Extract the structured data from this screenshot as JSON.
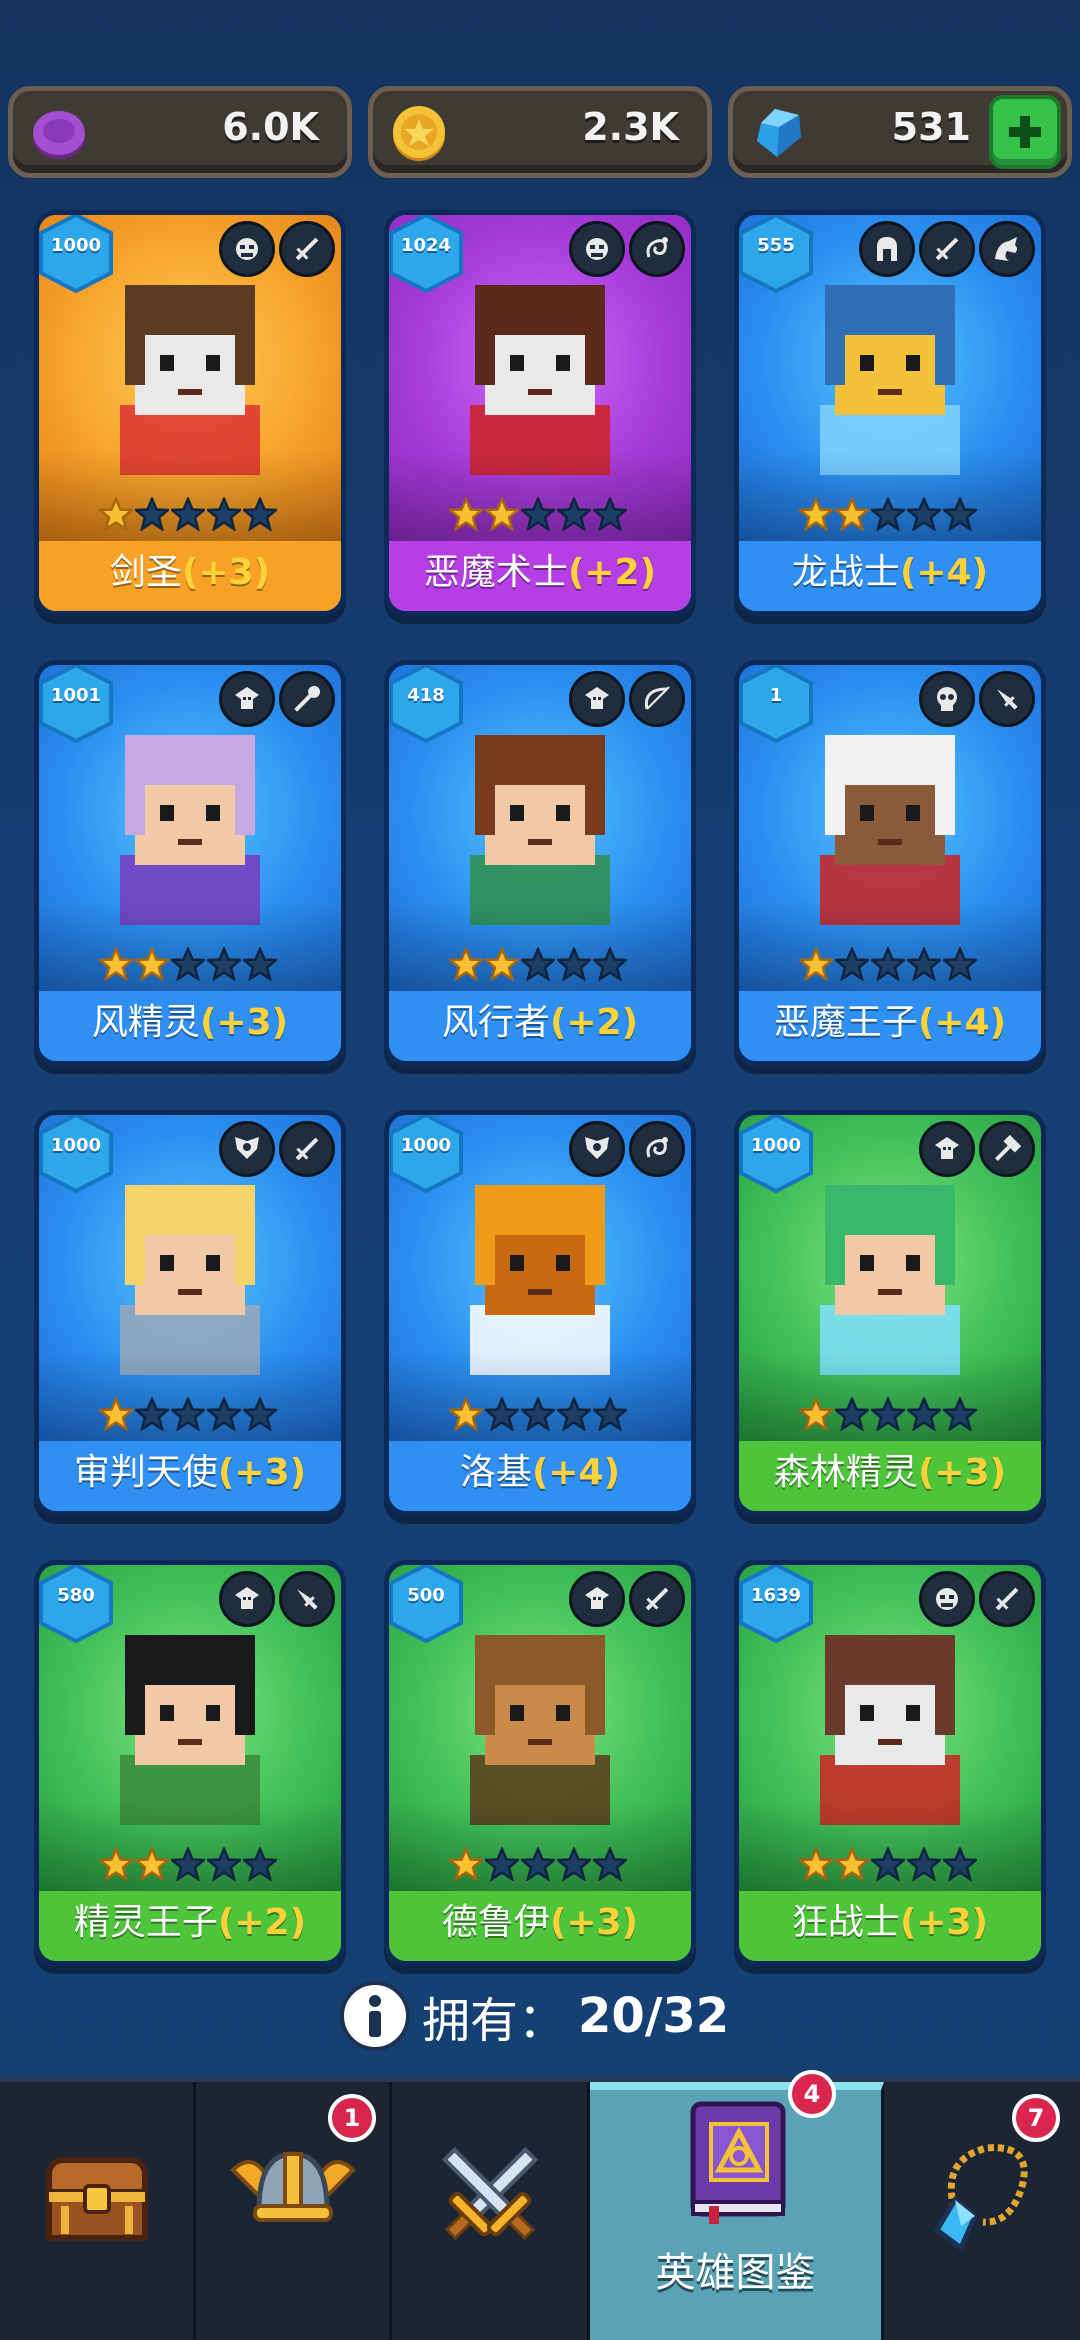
{
  "currency": {
    "elixir": "6.0K",
    "gold": "2.3K",
    "gems": "531"
  },
  "heroes": [
    {
      "name": "剑圣",
      "bonus": "(+3)",
      "level": "1000",
      "stars": 1,
      "rarity": "orange",
      "roles": [
        "orc-face-icon",
        "sword-icon"
      ]
    },
    {
      "name": "恶魔术士",
      "bonus": "(+2)",
      "level": "1024",
      "stars": 2,
      "rarity": "purple",
      "roles": [
        "orc-face-icon",
        "magic-swirl-icon"
      ]
    },
    {
      "name": "龙战士",
      "bonus": "(+4)",
      "level": "555",
      "stars": 2,
      "rarity": "blue",
      "roles": [
        "spartan-helmet-icon",
        "sword-icon",
        "dragon-icon"
      ]
    },
    {
      "name": "风精灵",
      "bonus": "(+3)",
      "level": "1001",
      "stars": 2,
      "rarity": "blue",
      "roles": [
        "elf-face-icon",
        "staff-icon"
      ]
    },
    {
      "name": "风行者",
      "bonus": "(+2)",
      "level": "418",
      "stars": 2,
      "rarity": "blue",
      "roles": [
        "elf-face-icon",
        "bow-icon"
      ]
    },
    {
      "name": "恶魔王子",
      "bonus": "(+4)",
      "level": "1",
      "stars": 1,
      "rarity": "blue",
      "roles": [
        "skull-icon",
        "dagger-icon"
      ]
    },
    {
      "name": "审判天使",
      "bonus": "(+3)",
      "level": "1000",
      "stars": 1,
      "rarity": "blue",
      "roles": [
        "winged-emblem-icon",
        "sword-icon"
      ]
    },
    {
      "name": "洛基",
      "bonus": "(+4)",
      "level": "1000",
      "stars": 1,
      "rarity": "blue",
      "roles": [
        "winged-emblem-icon",
        "magic-swirl-icon"
      ]
    },
    {
      "name": "森林精灵",
      "bonus": "(+3)",
      "level": "1000",
      "stars": 1,
      "rarity": "green",
      "roles": [
        "elf-face-icon",
        "hammer-icon"
      ]
    },
    {
      "name": "精灵王子",
      "bonus": "(+2)",
      "level": "580",
      "stars": 2,
      "rarity": "green",
      "roles": [
        "elf-face-icon",
        "dagger-icon"
      ]
    },
    {
      "name": "德鲁伊",
      "bonus": "(+3)",
      "level": "500",
      "stars": 1,
      "rarity": "green",
      "roles": [
        "elf-face-icon",
        "sword-icon"
      ]
    },
    {
      "name": "狂战士",
      "bonus": "(+3)",
      "level": "1639",
      "stars": 2,
      "rarity": "green",
      "roles": [
        "orc-face-icon",
        "sword-icon"
      ]
    }
  ],
  "owned": {
    "label": "拥有：",
    "count": "20/32"
  },
  "nav": {
    "items": [
      {
        "id": "chest",
        "icon": "treasure-chest-icon",
        "badge": ""
      },
      {
        "id": "heroes",
        "icon": "viking-helmet-icon",
        "badge": "1"
      },
      {
        "id": "battle",
        "icon": "crossed-swords-icon",
        "badge": ""
      },
      {
        "id": "codex",
        "icon": "spell-book-icon",
        "badge": "4",
        "label": "英雄图鉴"
      },
      {
        "id": "amulet",
        "icon": "amulet-icon",
        "badge": "7"
      }
    ]
  },
  "colors": {
    "background": "#173f74",
    "bonus": "#ffd23a",
    "orange": "#f39a22",
    "purple": "#b03be0",
    "blue": "#2f8ff2",
    "green": "#4ec43a",
    "star_filled": "#f9c132",
    "star_empty": "#1d3f66"
  }
}
